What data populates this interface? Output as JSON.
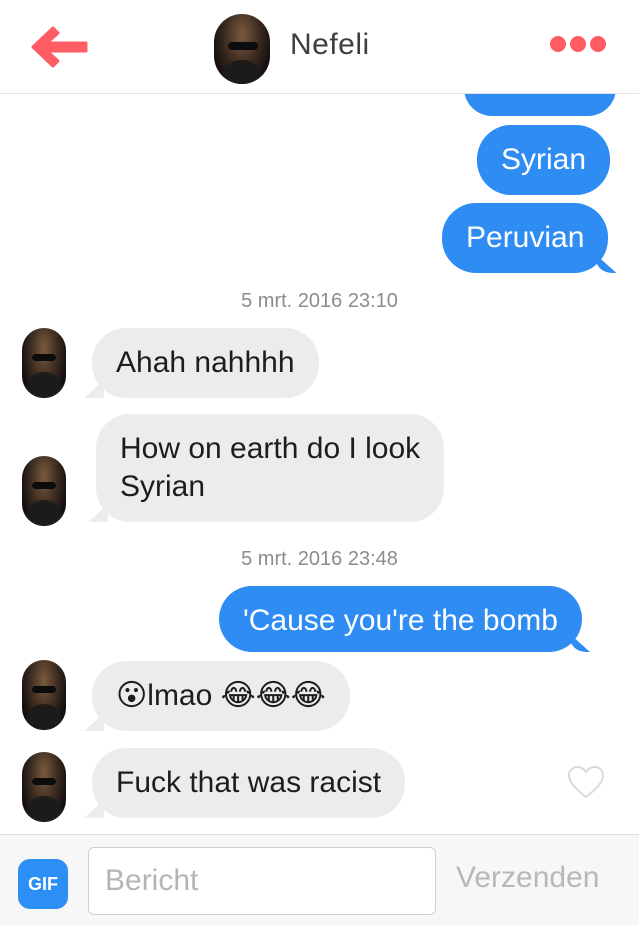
{
  "header": {
    "contact_name": "Nefeli",
    "back_icon": "arrow-left-icon",
    "menu_icon": "more-dots-icon",
    "accent_color": "#ff5c64"
  },
  "messages": [
    {
      "from": "me",
      "text": ""
    },
    {
      "from": "me",
      "text": "Syrian"
    },
    {
      "from": "me",
      "text": "Peruvian"
    },
    {
      "type": "timestamp",
      "text": "5 mrt. 2016 23:10"
    },
    {
      "from": "them",
      "text": "Ahah nahhhh"
    },
    {
      "from": "them",
      "lines": [
        "How on earth do I look",
        "Syrian"
      ]
    },
    {
      "type": "timestamp",
      "text": "5 mrt. 2016 23:48"
    },
    {
      "from": "me",
      "text": "'Cause you're the bomb"
    },
    {
      "from": "them",
      "emoji_lead": "😮",
      "text": "lmao",
      "emoji_tail": "😂😂😂"
    },
    {
      "from": "them",
      "text": "Fuck that was racist"
    }
  ],
  "like_icon": "heart-outline-icon",
  "composer": {
    "gif_label": "GIF",
    "placeholder": "Bericht",
    "value": "",
    "send_label": "Verzenden"
  },
  "colors": {
    "outgoing_bubble": "#2f8cf3",
    "incoming_bubble": "#ececec",
    "gif_button": "#2c8ff5"
  }
}
